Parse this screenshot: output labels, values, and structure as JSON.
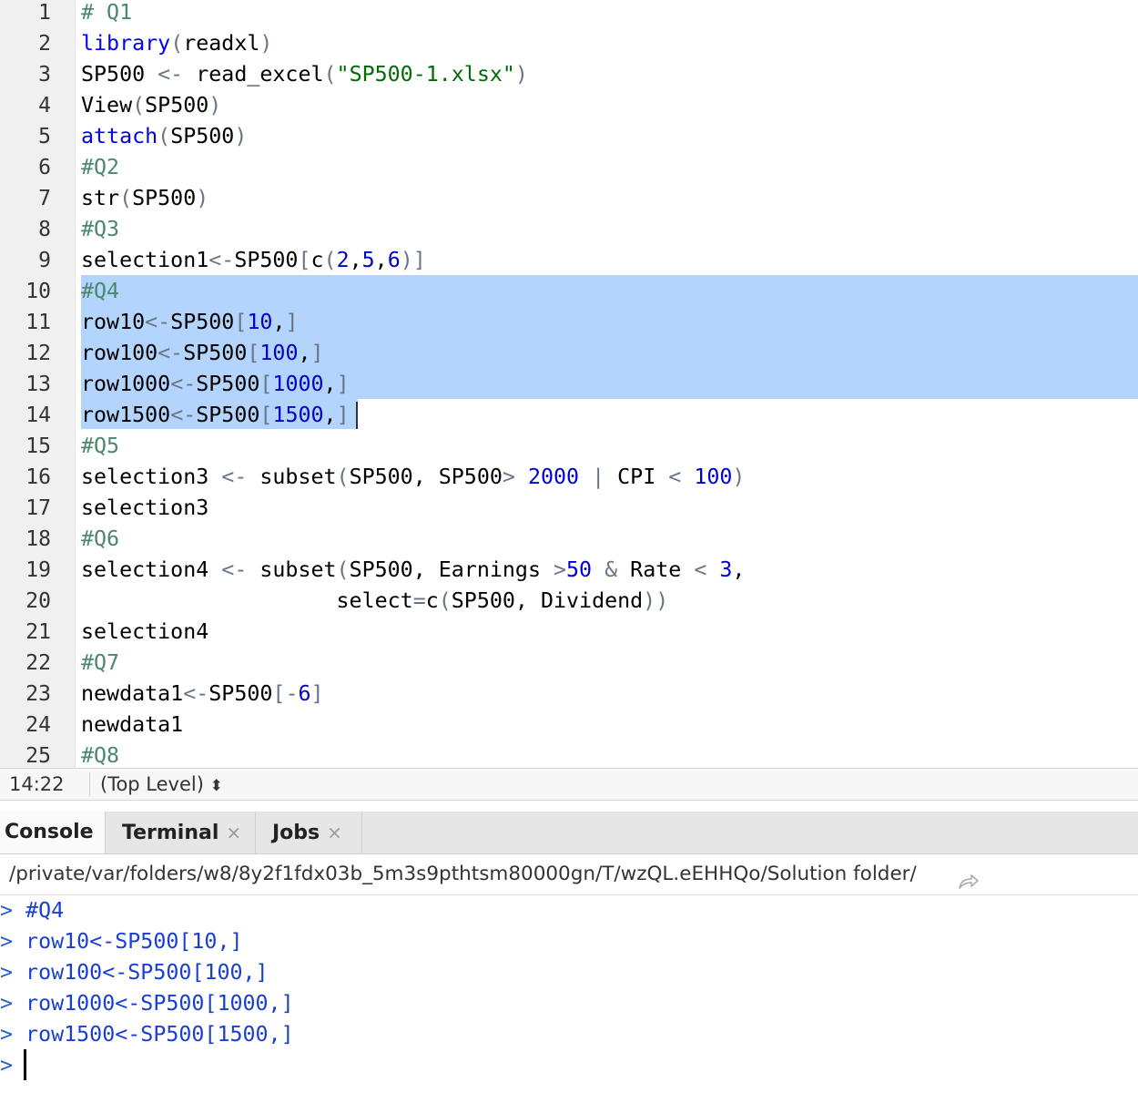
{
  "editor": {
    "lines": [
      {
        "num": "1",
        "tokens": [
          {
            "t": "# Q1",
            "c": "t-c"
          }
        ]
      },
      {
        "num": "2",
        "tokens": [
          {
            "t": "library",
            "c": "t-fn"
          },
          {
            "t": "(",
            "c": "t-p"
          },
          {
            "t": "readxl"
          },
          {
            "t": ")",
            "c": "t-p"
          }
        ]
      },
      {
        "num": "3",
        "tokens": [
          {
            "t": "SP500 "
          },
          {
            "t": "<-",
            "c": "t-o"
          },
          {
            "t": " read_excel"
          },
          {
            "t": "(",
            "c": "t-p"
          },
          {
            "t": "\"SP500-1.xlsx\"",
            "c": "t-s"
          },
          {
            "t": ")",
            "c": "t-p"
          }
        ]
      },
      {
        "num": "4",
        "tokens": [
          {
            "t": "View"
          },
          {
            "t": "(",
            "c": "t-p"
          },
          {
            "t": "SP500"
          },
          {
            "t": ")",
            "c": "t-p"
          }
        ]
      },
      {
        "num": "5",
        "tokens": [
          {
            "t": "attach",
            "c": "t-fn"
          },
          {
            "t": "(",
            "c": "t-p"
          },
          {
            "t": "SP500"
          },
          {
            "t": ")",
            "c": "t-p"
          }
        ]
      },
      {
        "num": "6",
        "tokens": [
          {
            "t": "#Q2",
            "c": "t-c"
          }
        ]
      },
      {
        "num": "7",
        "tokens": [
          {
            "t": "str"
          },
          {
            "t": "(",
            "c": "t-p"
          },
          {
            "t": "SP500"
          },
          {
            "t": ")",
            "c": "t-p"
          }
        ]
      },
      {
        "num": "8",
        "tokens": [
          {
            "t": "#Q3",
            "c": "t-c"
          }
        ]
      },
      {
        "num": "9",
        "tokens": [
          {
            "t": "selection1"
          },
          {
            "t": "<-",
            "c": "t-o"
          },
          {
            "t": "SP500"
          },
          {
            "t": "[",
            "c": "t-p"
          },
          {
            "t": "c"
          },
          {
            "t": "(",
            "c": "t-p"
          },
          {
            "t": "2",
            "c": "t-n"
          },
          {
            "t": ","
          },
          {
            "t": "5",
            "c": "t-n"
          },
          {
            "t": ","
          },
          {
            "t": "6",
            "c": "t-n"
          },
          {
            "t": ")]",
            "c": "t-p"
          }
        ]
      },
      {
        "num": "10",
        "tokens": [
          {
            "t": "#Q4",
            "c": "t-c"
          }
        ]
      },
      {
        "num": "11",
        "tokens": [
          {
            "t": "row10"
          },
          {
            "t": "<-",
            "c": "t-o"
          },
          {
            "t": "SP500"
          },
          {
            "t": "[",
            "c": "t-p"
          },
          {
            "t": "10",
            "c": "t-n"
          },
          {
            "t": ","
          },
          {
            "t": "]",
            "c": "t-p"
          }
        ]
      },
      {
        "num": "12",
        "tokens": [
          {
            "t": "row100"
          },
          {
            "t": "<-",
            "c": "t-o"
          },
          {
            "t": "SP500"
          },
          {
            "t": "[",
            "c": "t-p"
          },
          {
            "t": "100",
            "c": "t-n"
          },
          {
            "t": ","
          },
          {
            "t": "]",
            "c": "t-p"
          }
        ]
      },
      {
        "num": "13",
        "tokens": [
          {
            "t": "row1000"
          },
          {
            "t": "<-",
            "c": "t-o"
          },
          {
            "t": "SP500"
          },
          {
            "t": "[",
            "c": "t-p"
          },
          {
            "t": "1000",
            "c": "t-n"
          },
          {
            "t": ","
          },
          {
            "t": "]",
            "c": "t-p"
          }
        ]
      },
      {
        "num": "14",
        "tokens": [
          {
            "t": "row1500"
          },
          {
            "t": "<-",
            "c": "t-o"
          },
          {
            "t": "SP500"
          },
          {
            "t": "[",
            "c": "t-p"
          },
          {
            "t": "1500",
            "c": "t-n"
          },
          {
            "t": ","
          },
          {
            "t": "]",
            "c": "t-p"
          }
        ]
      },
      {
        "num": "15",
        "tokens": [
          {
            "t": "#Q5",
            "c": "t-c"
          }
        ]
      },
      {
        "num": "16",
        "tokens": [
          {
            "t": "selection3 "
          },
          {
            "t": "<-",
            "c": "t-o"
          },
          {
            "t": " subset"
          },
          {
            "t": "(",
            "c": "t-p"
          },
          {
            "t": "SP500, SP500"
          },
          {
            "t": ">",
            "c": "t-o"
          },
          {
            "t": " "
          },
          {
            "t": "2000",
            "c": "t-n"
          },
          {
            "t": " "
          },
          {
            "t": "|",
            "c": "t-o"
          },
          {
            "t": " CPI "
          },
          {
            "t": "<",
            "c": "t-o"
          },
          {
            "t": " "
          },
          {
            "t": "100",
            "c": "t-n"
          },
          {
            "t": ")",
            "c": "t-p"
          }
        ]
      },
      {
        "num": "17",
        "tokens": [
          {
            "t": "selection3"
          }
        ]
      },
      {
        "num": "18",
        "tokens": [
          {
            "t": "#Q6",
            "c": "t-c"
          }
        ]
      },
      {
        "num": "19",
        "tokens": [
          {
            "t": "selection4 "
          },
          {
            "t": "<-",
            "c": "t-o"
          },
          {
            "t": " subset"
          },
          {
            "t": "(",
            "c": "t-p"
          },
          {
            "t": "SP500, Earnings "
          },
          {
            "t": ">",
            "c": "t-o"
          },
          {
            "t": "50",
            "c": "t-n"
          },
          {
            "t": " "
          },
          {
            "t": "&",
            "c": "t-o"
          },
          {
            "t": " Rate "
          },
          {
            "t": "<",
            "c": "t-o"
          },
          {
            "t": " "
          },
          {
            "t": "3",
            "c": "t-n"
          },
          {
            "t": ","
          }
        ]
      },
      {
        "num": "20",
        "tokens": [
          {
            "t": "                    select"
          },
          {
            "t": "=",
            "c": "t-o"
          },
          {
            "t": "c"
          },
          {
            "t": "(",
            "c": "t-p"
          },
          {
            "t": "SP500, Dividend"
          },
          {
            "t": "))",
            "c": "t-p"
          }
        ]
      },
      {
        "num": "21",
        "tokens": [
          {
            "t": "selection4"
          }
        ]
      },
      {
        "num": "22",
        "tokens": [
          {
            "t": "#Q7",
            "c": "t-c"
          }
        ]
      },
      {
        "num": "23",
        "tokens": [
          {
            "t": "newdata1"
          },
          {
            "t": "<-",
            "c": "t-o"
          },
          {
            "t": "SP500"
          },
          {
            "t": "[-",
            "c": "t-p"
          },
          {
            "t": "6",
            "c": "t-n"
          },
          {
            "t": "]",
            "c": "t-p"
          }
        ]
      },
      {
        "num": "24",
        "tokens": [
          {
            "t": "newdata1"
          }
        ]
      },
      {
        "num": "25",
        "tokens": [
          {
            "t": "#Q8",
            "c": "t-c"
          }
        ]
      }
    ]
  },
  "status": {
    "position": "14:22",
    "scope": "(Top Level)",
    "scope_arrow": "⬍"
  },
  "tabs": [
    {
      "label": "Console",
      "closable": false
    },
    {
      "label": "Terminal",
      "closable": true
    },
    {
      "label": "Jobs",
      "closable": true
    }
  ],
  "tab_close_glyph": "×",
  "path": {
    "text": "/private/var/folders/w8/8y2f1fdx03b_5m3s9pthtsm80000gn/T/wzQL.eEHHQo/Solution folder/"
  },
  "console": {
    "prompt": ">",
    "lines": [
      "#Q4",
      "row10<-SP500[10,]",
      "row100<-SP500[100,]",
      "row1000<-SP500[1000,]",
      "row1500<-SP500[1500,]",
      ""
    ]
  }
}
